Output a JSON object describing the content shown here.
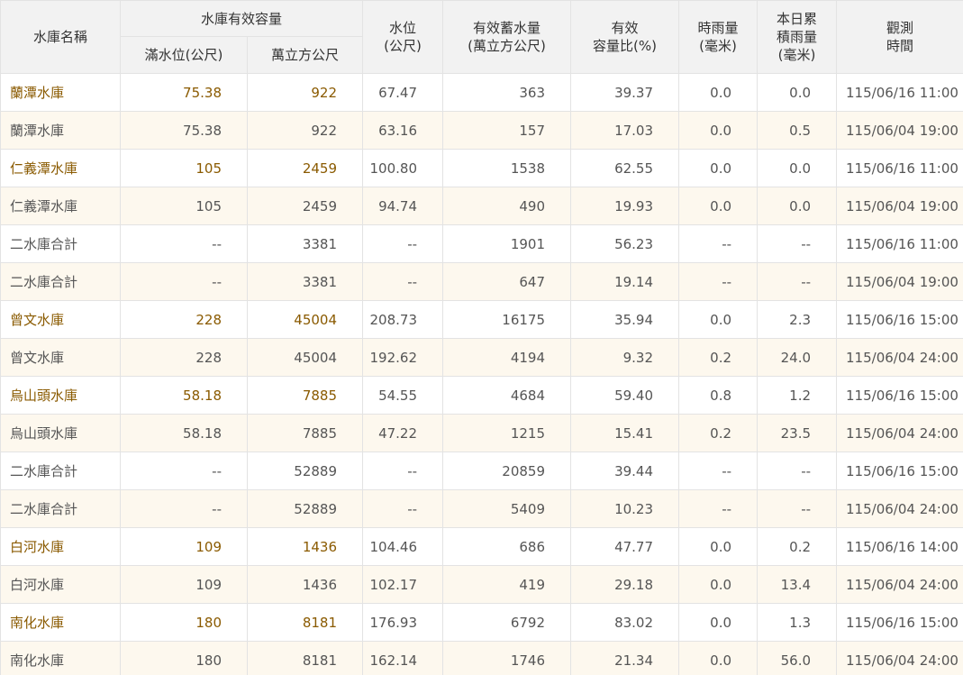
{
  "header": {
    "name": "水庫名稱",
    "capacity_group": "水庫有效容量",
    "full_level": "滿水位(公尺)",
    "capacity": "萬立方公尺",
    "level": [
      "水位",
      "(公尺)"
    ],
    "storage": [
      "有效蓄水量",
      "(萬立方公尺)"
    ],
    "ratio": [
      "有效",
      "容量比(%)"
    ],
    "hourly_rain": [
      "時雨量",
      "(毫米)"
    ],
    "daily_rain": [
      "本日累",
      "積雨量",
      "(毫米)"
    ],
    "time": [
      "觀測",
      "時間"
    ]
  },
  "rows": [
    {
      "name": "蘭潭水庫",
      "full": "75.38",
      "cap": "922",
      "level": "67.47",
      "storage": "363",
      "ratio": "39.37",
      "hr": "0.0",
      "dr": "0.0",
      "time": "115/06/16 11:00",
      "main": true
    },
    {
      "name": "蘭潭水庫",
      "full": "75.38",
      "cap": "922",
      "level": "63.16",
      "storage": "157",
      "ratio": "17.03",
      "hr": "0.0",
      "dr": "0.5",
      "time": "115/06/04 19:00",
      "main": false
    },
    {
      "name": "仁義潭水庫",
      "full": "105",
      "cap": "2459",
      "level": "100.80",
      "storage": "1538",
      "ratio": "62.55",
      "hr": "0.0",
      "dr": "0.0",
      "time": "115/06/16 11:00",
      "main": true
    },
    {
      "name": "仁義潭水庫",
      "full": "105",
      "cap": "2459",
      "level": "94.74",
      "storage": "490",
      "ratio": "19.93",
      "hr": "0.0",
      "dr": "0.0",
      "time": "115/06/04 19:00",
      "main": false
    },
    {
      "name": "二水庫合計",
      "full": "--",
      "cap": "3381",
      "level": "--",
      "storage": "1901",
      "ratio": "56.23",
      "hr": "--",
      "dr": "--",
      "time": "115/06/16 11:00",
      "main": false
    },
    {
      "name": "二水庫合計",
      "full": "--",
      "cap": "3381",
      "level": "--",
      "storage": "647",
      "ratio": "19.14",
      "hr": "--",
      "dr": "--",
      "time": "115/06/04 19:00",
      "main": false
    },
    {
      "name": "曾文水庫",
      "full": "228",
      "cap": "45004",
      "level": "208.73",
      "storage": "16175",
      "ratio": "35.94",
      "hr": "0.0",
      "dr": "2.3",
      "time": "115/06/16 15:00",
      "main": true
    },
    {
      "name": "曾文水庫",
      "full": "228",
      "cap": "45004",
      "level": "192.62",
      "storage": "4194",
      "ratio": "9.32",
      "hr": "0.2",
      "dr": "24.0",
      "time": "115/06/04 24:00",
      "main": false
    },
    {
      "name": "烏山頭水庫",
      "full": "58.18",
      "cap": "7885",
      "level": "54.55",
      "storage": "4684",
      "ratio": "59.40",
      "hr": "0.8",
      "dr": "1.2",
      "time": "115/06/16 15:00",
      "main": true
    },
    {
      "name": "烏山頭水庫",
      "full": "58.18",
      "cap": "7885",
      "level": "47.22",
      "storage": "1215",
      "ratio": "15.41",
      "hr": "0.2",
      "dr": "23.5",
      "time": "115/06/04 24:00",
      "main": false
    },
    {
      "name": "二水庫合計",
      "full": "--",
      "cap": "52889",
      "level": "--",
      "storage": "20859",
      "ratio": "39.44",
      "hr": "--",
      "dr": "--",
      "time": "115/06/16 15:00",
      "main": false
    },
    {
      "name": "二水庫合計",
      "full": "--",
      "cap": "52889",
      "level": "--",
      "storage": "5409",
      "ratio": "10.23",
      "hr": "--",
      "dr": "--",
      "time": "115/06/04 24:00",
      "main": false
    },
    {
      "name": "白河水庫",
      "full": "109",
      "cap": "1436",
      "level": "104.46",
      "storage": "686",
      "ratio": "47.77",
      "hr": "0.0",
      "dr": "0.2",
      "time": "115/06/16 14:00",
      "main": true
    },
    {
      "name": "白河水庫",
      "full": "109",
      "cap": "1436",
      "level": "102.17",
      "storage": "419",
      "ratio": "29.18",
      "hr": "0.0",
      "dr": "13.4",
      "time": "115/06/04 24:00",
      "main": false
    },
    {
      "name": "南化水庫",
      "full": "180",
      "cap": "8181",
      "level": "176.93",
      "storage": "6792",
      "ratio": "83.02",
      "hr": "0.0",
      "dr": "1.3",
      "time": "115/06/16 15:00",
      "main": true
    },
    {
      "name": "南化水庫",
      "full": "180",
      "cap": "8181",
      "level": "162.14",
      "storage": "1746",
      "ratio": "21.34",
      "hr": "0.0",
      "dr": "56.0",
      "time": "115/06/04 24:00",
      "main": false
    }
  ],
  "colors": {
    "header_bg": "#f2f2f2",
    "alt_row_bg": "#fdf8ee",
    "link_text": "#8a5a00",
    "body_text": "#555555",
    "border": "#e3e3e3"
  }
}
